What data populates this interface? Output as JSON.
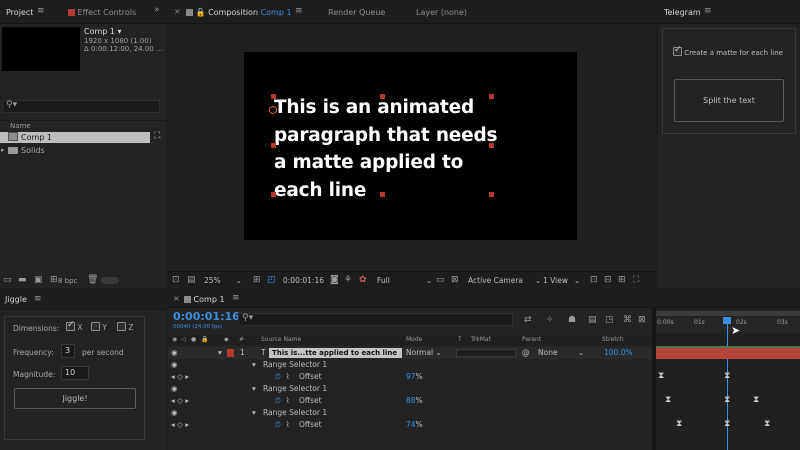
{
  "project_panel": {
    "tab_project": "Project",
    "tab_effect_controls": "Effect Controls",
    "comp_name": "Comp 1",
    "comp_dims": "1920 x 1080 (1.00)",
    "comp_duration": "Δ 0:00:12:00, 24.00 ...",
    "col_name": "Name",
    "items": [
      {
        "label": "Comp 1",
        "icon": "composition-icon",
        "selected": true
      },
      {
        "label": "Solids",
        "icon": "folder-icon",
        "selected": false
      }
    ],
    "bpc": "8 bpc"
  },
  "jiggle_panel": {
    "title": "Jiggle",
    "dimensions_label": "Dimensions:",
    "dims": [
      {
        "label": "X",
        "checked": true
      },
      {
        "label": "Y",
        "checked": false
      },
      {
        "label": "Z",
        "checked": false
      }
    ],
    "frequency_label": "Frequency:",
    "frequency_value": "3",
    "frequency_unit": "per second",
    "magnitude_label": "Magnitude:",
    "magnitude_value": "10",
    "button": "Jiggle!"
  },
  "viewer": {
    "tab_prefix": "Composition",
    "tab_comp": "Comp 1",
    "tab_render_queue": "Render Queue",
    "tab_layer": "Layer (none)",
    "comp_text": [
      "This is an animated",
      "paragraph that needs",
      "a matte applied to",
      "each line"
    ],
    "zoom": "25%",
    "timecode": "0:00:01:16",
    "resolution": "Full",
    "camera": "Active Camera",
    "view": "1 View"
  },
  "telegram": {
    "title": "Telegram",
    "checkbox_label": "Create a matte for each line",
    "checkbox_checked": true,
    "button": "Split the text"
  },
  "timeline": {
    "tab": "Comp 1",
    "timecode": "0:00:01:16",
    "timecode_sub": "00040 (24.00 fps)",
    "headers": {
      "hash": "#",
      "source_name": "Source Name",
      "mode": "Mode",
      "t": "T",
      "trkmat": "TrkMat",
      "parent": "Parent",
      "stretch": "Stretch"
    },
    "layer": {
      "number": "1",
      "type_icon": "T",
      "name": "This is...tte applied to  each line",
      "mode": "Normal",
      "parent": "None",
      "stretch": "100.0%"
    },
    "selectors": [
      {
        "name": "Range Selector 1",
        "prop": "Offset",
        "value": "97",
        "unit": "%"
      },
      {
        "name": "Range Selector 1",
        "prop": "Offset",
        "value": "88",
        "unit": "%"
      },
      {
        "name": "Range Selector 1",
        "prop": "Offset",
        "value": "74",
        "unit": "%"
      }
    ],
    "ruler": [
      "0:00s",
      "01s",
      "02s",
      "03s"
    ]
  },
  "colors": {
    "accent_blue": "#3a8fe0",
    "layer_bar": "#b5453b",
    "label_red": "#b23a30"
  }
}
